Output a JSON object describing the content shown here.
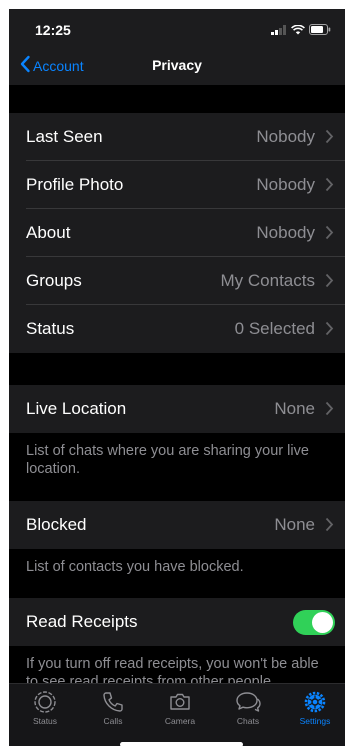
{
  "status_bar": {
    "time": "12:25"
  },
  "nav": {
    "back_label": "Account",
    "title": "Privacy"
  },
  "privacy_rows": [
    {
      "label": "Last Seen",
      "value": "Nobody"
    },
    {
      "label": "Profile Photo",
      "value": "Nobody"
    },
    {
      "label": "About",
      "value": "Nobody"
    },
    {
      "label": "Groups",
      "value": "My Contacts"
    },
    {
      "label": "Status",
      "value": "0 Selected"
    }
  ],
  "live_location": {
    "label": "Live Location",
    "value": "None",
    "footer": "List of chats where you are sharing your live location."
  },
  "blocked": {
    "label": "Blocked",
    "value": "None",
    "footer": "List of contacts you have blocked."
  },
  "read_receipts": {
    "label": "Read Receipts",
    "enabled": true,
    "footer": "If you turn off read receipts, you won't be able to see read receipts from other people."
  },
  "tabs": [
    {
      "label": "Status",
      "icon": "status-icon",
      "active": false
    },
    {
      "label": "Calls",
      "icon": "phone-icon",
      "active": false
    },
    {
      "label": "Camera",
      "icon": "camera-icon",
      "active": false
    },
    {
      "label": "Chats",
      "icon": "chat-bubbles-icon",
      "active": false
    },
    {
      "label": "Settings",
      "icon": "gear-icon",
      "active": true
    }
  ],
  "colors": {
    "accent": "#0a84ff",
    "toggle_on": "#30d158",
    "cell_background": "#1c1c1e",
    "secondary_text": "#8e8e93"
  }
}
